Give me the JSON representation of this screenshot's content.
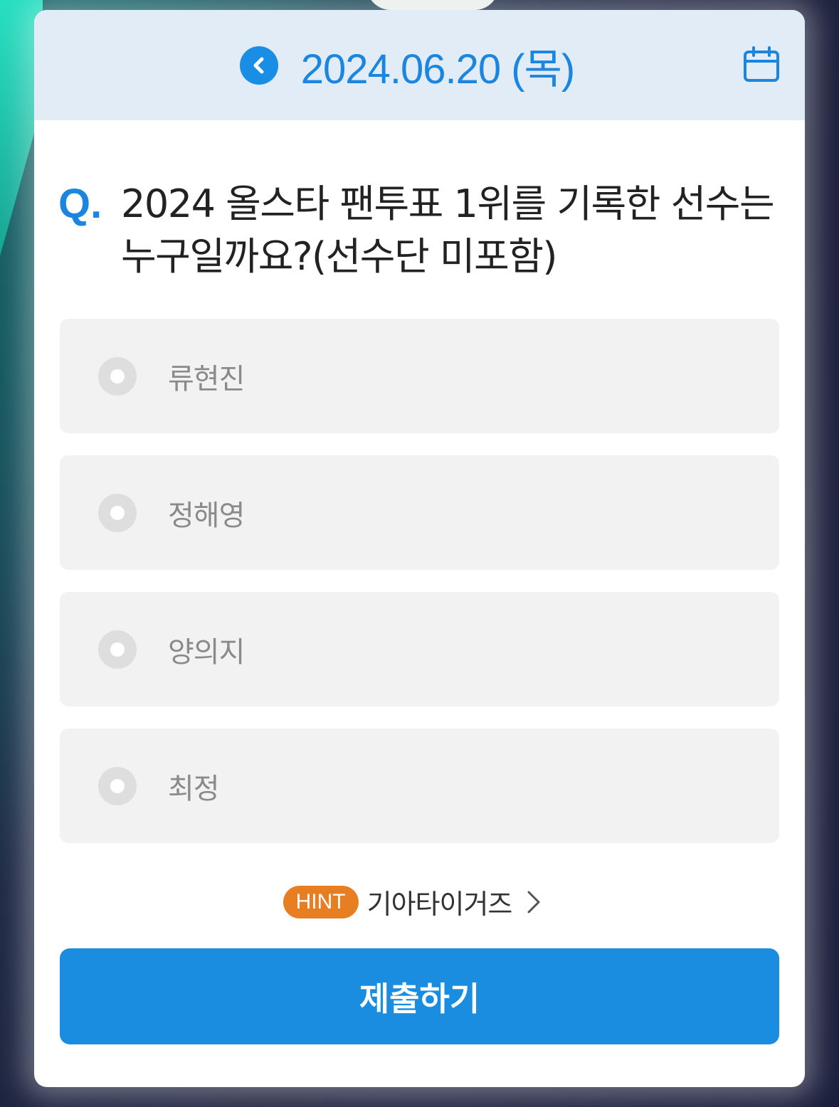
{
  "header": {
    "date": "2024.06.20 (목)"
  },
  "question": {
    "mark": "Q.",
    "text": "2024 올스타 팬투표 1위를 기록한 선수는 누구일까요?(선수단 미포함)"
  },
  "options": [
    {
      "label": "류현진",
      "selected": false
    },
    {
      "label": "정해영",
      "selected": false
    },
    {
      "label": "양의지",
      "selected": false
    },
    {
      "label": "최정",
      "selected": false
    }
  ],
  "hint": {
    "badge": "HINT",
    "text": "기아타이거즈"
  },
  "submit": {
    "label": "제출하기"
  },
  "colors": {
    "accent": "#1a8de4",
    "hint": "#e87e22",
    "header_bg": "#e1ecf7",
    "option_bg": "#f2f2f2"
  },
  "icons": [
    "chevron-left-icon",
    "calendar-icon",
    "radio-icon",
    "chevron-right-icon"
  ]
}
